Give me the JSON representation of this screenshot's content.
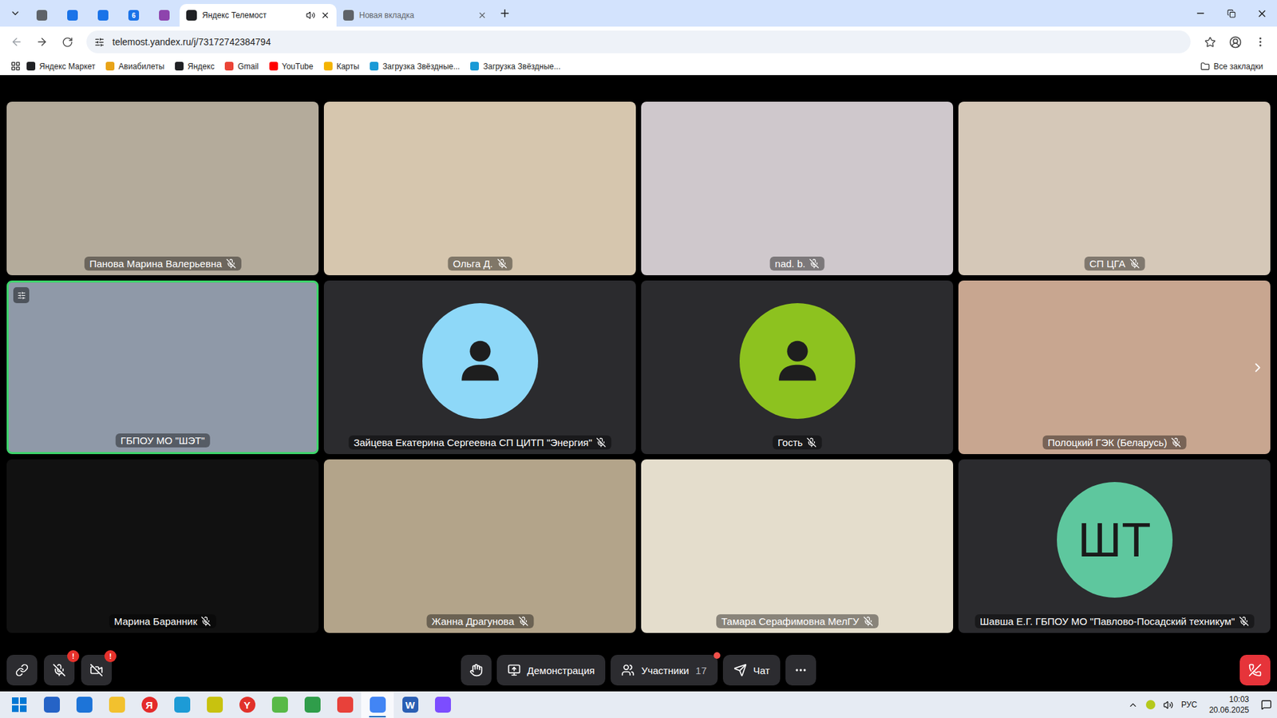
{
  "browser": {
    "tabs": [
      {
        "kind": "favicon",
        "color": "#5f6368",
        "selected": false
      },
      {
        "kind": "favicon",
        "color": "#1a73e8",
        "selected": false
      },
      {
        "kind": "favicon",
        "color": "#1a73e8",
        "selected": false
      },
      {
        "kind": "favicon",
        "color": "#1a73e8",
        "icon_text": "6",
        "selected": false
      },
      {
        "kind": "favicon",
        "color": "#8e44ad",
        "selected": false
      },
      {
        "kind": "page",
        "label": "Яндекс Телемост",
        "color": "#202124",
        "audio": true,
        "selected": true
      },
      {
        "kind": "page",
        "label": "Новая вкладка",
        "color": "#5f6368",
        "audio": false,
        "selected": false
      }
    ],
    "address": "telemost.yandex.ru/j/73172742384794",
    "bookmarks": [
      {
        "label": "Яндекс Маркет",
        "color": "#202124"
      },
      {
        "label": "Авиабилеты",
        "color": "#e8a317"
      },
      {
        "label": "Яндекс",
        "color": "#202124"
      },
      {
        "label": "Gmail",
        "color": "#ea4335"
      },
      {
        "label": "YouTube",
        "color": "#ff0000"
      },
      {
        "label": "Карты",
        "color": "#f4b400"
      },
      {
        "label": "Загрузка Звёздные...",
        "color": "#1a9ad6"
      },
      {
        "label": "Загрузка Звёздные...",
        "color": "#1a9ad6"
      }
    ],
    "all_bookmarks": "Все закладки"
  },
  "meeting": {
    "tiles": [
      {
        "name": "Панова Марина Валерьевна",
        "kind": "video",
        "color": "#b4ab9b",
        "muted": true,
        "speaking": false
      },
      {
        "name": "Ольга Д.",
        "kind": "video",
        "color": "#d6c6ae",
        "muted": true,
        "speaking": false
      },
      {
        "name": "nad. b.",
        "kind": "video",
        "color": "#cfc8cc",
        "muted": true,
        "speaking": false
      },
      {
        "name": "СП ЦГА",
        "kind": "video",
        "color": "#d5c8b8",
        "muted": true,
        "speaking": false
      },
      {
        "name": "ГБПОУ МО \"ШЭТ\"",
        "kind": "video",
        "color": "#8f99a8",
        "muted": false,
        "speaking": true
      },
      {
        "name": "Зайцева Екатерина Сергеевна СП ЦИТП \"Энергия\"",
        "kind": "avatar",
        "color": "#8ed8f8",
        "muted": true,
        "speaking": false
      },
      {
        "name": "Гость",
        "kind": "avatar",
        "color": "#8dc21f",
        "muted": true,
        "speaking": false
      },
      {
        "name": "Полоцкий ГЭК (Беларусь)",
        "kind": "video",
        "color": "#c8a690",
        "muted": true,
        "speaking": false
      },
      {
        "name": "Марина Баранник",
        "kind": "blank",
        "color": "#111111",
        "muted": true,
        "speaking": false
      },
      {
        "name": "Жанна Драгунова",
        "kind": "video",
        "color": "#b3a48a",
        "muted": true,
        "speaking": false
      },
      {
        "name": "Тамара Серафимовна МелГУ",
        "kind": "video",
        "color": "#e4ddcc",
        "muted": true,
        "speaking": false
      },
      {
        "name": "Шавша Е.Г. ГБПОУ МО \"Павлово-Посадский техникум\"",
        "kind": "initials",
        "initials": "ШТ",
        "color": "#5ec79e",
        "muted": true,
        "speaking": false
      }
    ],
    "next_page": true,
    "toolbar": {
      "mic": {
        "muted": true,
        "badge": "!"
      },
      "camera": {
        "off": true,
        "badge": "!"
      },
      "buttons": [
        {
          "kind": "hand"
        },
        {
          "kind": "screen",
          "label": "Демонстрация"
        },
        {
          "kind": "participants",
          "label": "Участники",
          "count": "17",
          "notification": true
        },
        {
          "kind": "chat",
          "label": "Чат"
        },
        {
          "kind": "more"
        }
      ]
    }
  },
  "taskbar": {
    "apps": [
      {
        "color": "#2563c6",
        "selected": false
      },
      {
        "color": "#1d74d8",
        "selected": false
      },
      {
        "color": "#f2c12e",
        "selected": false
      },
      {
        "color": "#e42a2a",
        "glyph": "Я",
        "selected": false
      },
      {
        "color": "#1d9bd6",
        "selected": false
      },
      {
        "color": "#c8c20f",
        "selected": false
      },
      {
        "color": "#e1312a",
        "glyph": "Y",
        "selected": false
      },
      {
        "color": "#58b947",
        "selected": false
      },
      {
        "color": "#2f9d4a",
        "selected": false
      },
      {
        "color": "#e8413a",
        "selected": false
      },
      {
        "color": "#4285f4",
        "selected": true
      },
      {
        "color": "#2b5fb4",
        "glyph": "W",
        "selected": false
      },
      {
        "color": "#7c4dff",
        "selected": false
      }
    ],
    "language": "РУС",
    "time": "10:03",
    "date": "20.06.2025"
  }
}
